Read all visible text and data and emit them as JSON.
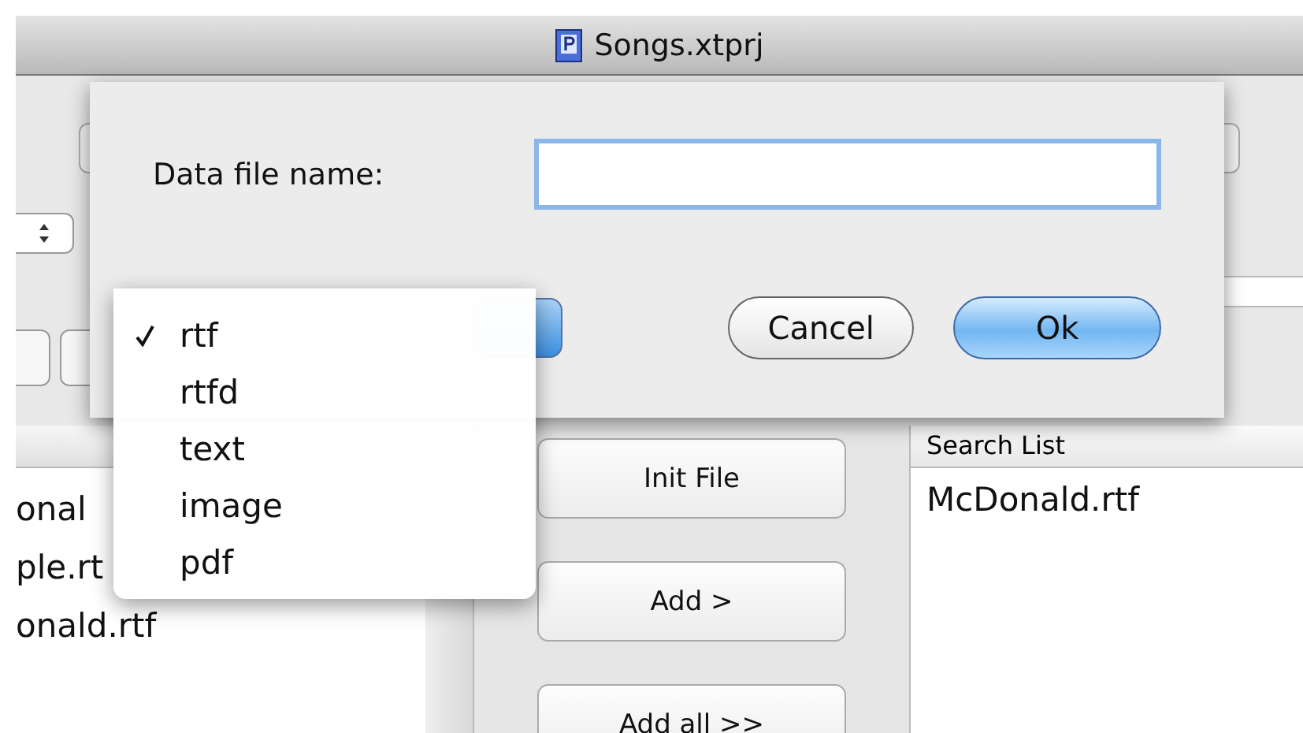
{
  "window": {
    "title": "Songs.xtprj"
  },
  "sheet": {
    "label": "Data file name:",
    "name_field": {
      "focused": true
    },
    "buttons": [
      {
        "label": "Cancel",
        "default": false
      },
      {
        "label": "Ok",
        "default": true
      }
    ]
  },
  "format_menu": {
    "items": [
      {
        "label": "rtf",
        "checked": true
      },
      {
        "label": "rtfd",
        "checked": false
      },
      {
        "label": "text",
        "checked": false
      },
      {
        "label": "image",
        "checked": false
      },
      {
        "label": "pdf",
        "checked": false
      }
    ]
  },
  "file_list": {
    "rows": [
      "onal",
      "ple.rt",
      "onald.rtf"
    ]
  },
  "actions": [
    "Init File",
    "Add >",
    "Add all >>"
  ],
  "search_list": {
    "header": "Search List",
    "rows": [
      "McDonald.rtf"
    ]
  }
}
